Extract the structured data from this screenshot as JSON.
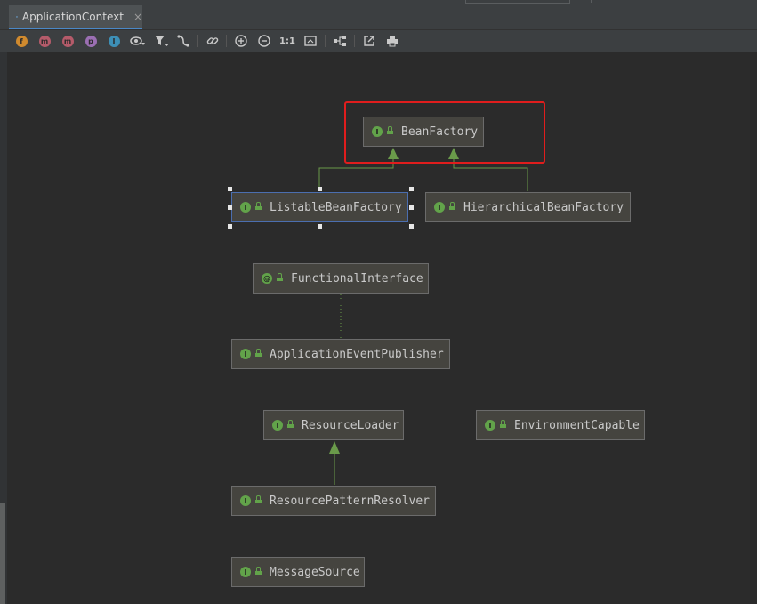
{
  "tab": {
    "title": "ApplicationContext",
    "close": "×",
    "active": true
  },
  "toolbar": {
    "buttons": [
      {
        "name": "fields-filter-icon",
        "glyph": "f",
        "color": "#d08a2e"
      },
      {
        "name": "constructors-filter-icon",
        "glyph": "m",
        "color": "#b55b6a"
      },
      {
        "name": "methods-filter-icon",
        "glyph": "m",
        "color": "#b55b6a"
      },
      {
        "name": "properties-filter-icon",
        "glyph": "p",
        "color": "#9b6fb3"
      },
      {
        "name": "inner-classes-filter-icon",
        "glyph": "I",
        "color": "#3d8fb6"
      }
    ],
    "actual_size": "1:1"
  },
  "diagram": {
    "nodes": [
      {
        "id": "bean-factory",
        "label": "BeanFactory",
        "icon": "I"
      },
      {
        "id": "listable-bean-factory",
        "label": "ListableBeanFactory",
        "icon": "I",
        "selected": true
      },
      {
        "id": "hierarchical-bean-factory",
        "label": "HierarchicalBeanFactory",
        "icon": "I"
      },
      {
        "id": "functional-interface",
        "label": "FunctionalInterface",
        "icon": "@"
      },
      {
        "id": "application-event-publisher",
        "label": "ApplicationEventPublisher",
        "icon": "I"
      },
      {
        "id": "resource-loader",
        "label": "ResourceLoader",
        "icon": "I"
      },
      {
        "id": "environment-capable",
        "label": "EnvironmentCapable",
        "icon": "I"
      },
      {
        "id": "resource-pattern-resolver",
        "label": "ResourcePatternResolver",
        "icon": "I"
      },
      {
        "id": "message-source",
        "label": "MessageSource",
        "icon": "I"
      }
    ],
    "edges": [
      {
        "from": "listable-bean-factory",
        "to": "bean-factory",
        "kind": "extends"
      },
      {
        "from": "hierarchical-bean-factory",
        "to": "bean-factory",
        "kind": "extends"
      },
      {
        "from": "application-event-publisher",
        "to": "functional-interface",
        "kind": "annotated"
      },
      {
        "from": "resource-pattern-resolver",
        "to": "resource-loader",
        "kind": "extends"
      }
    ]
  },
  "colors": {
    "background": "#2b2b2b",
    "node_fill": "#45443f",
    "interface_icon": "#62a34a",
    "edge": "#6a9a4a",
    "highlight": "#e01d1d",
    "selection": "#4b6eaf"
  }
}
